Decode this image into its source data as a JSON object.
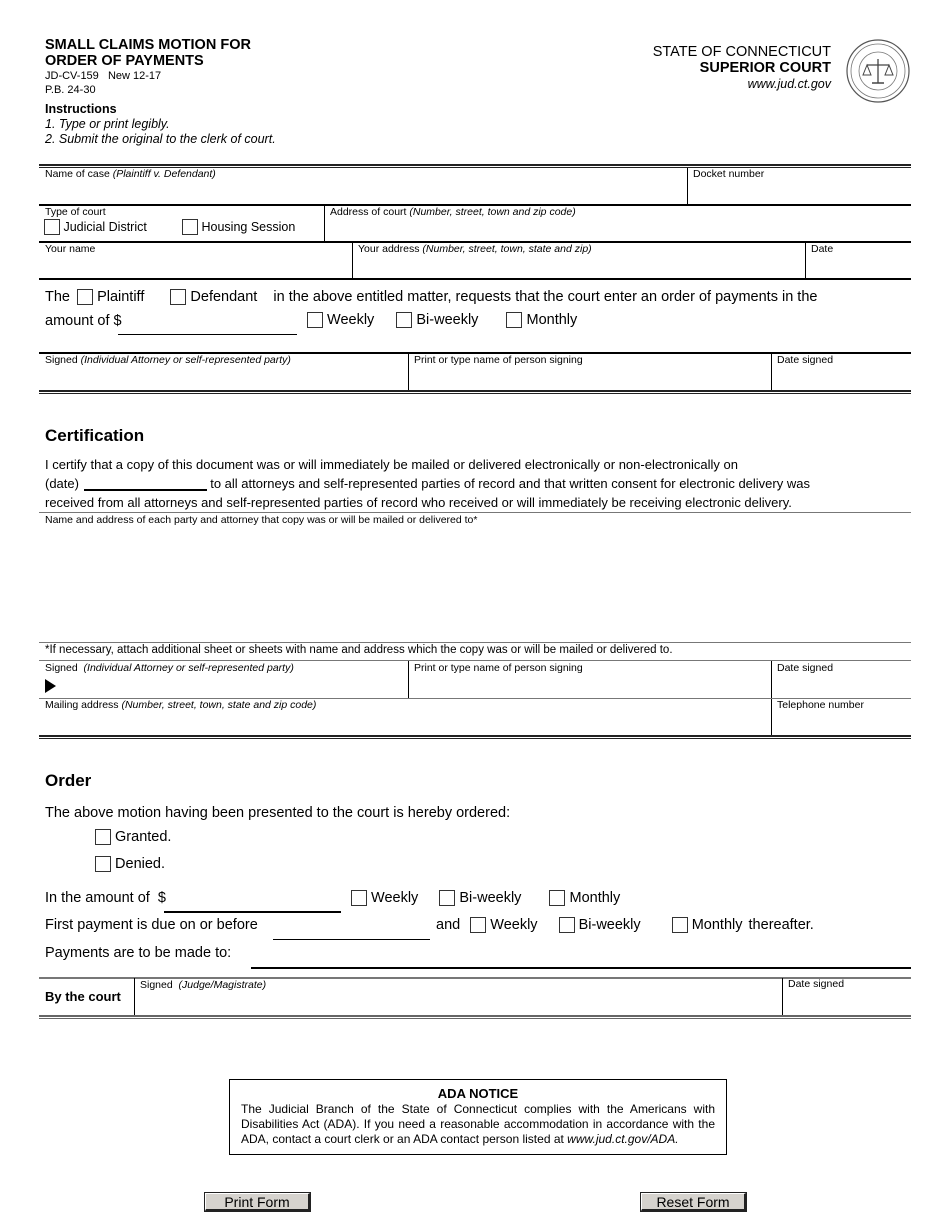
{
  "header": {
    "title_line1": "SMALL CLAIMS MOTION FOR",
    "title_line2": "ORDER OF PAYMENTS",
    "form_number": "JD-CV-159   New 12-17",
    "practice_book": "P.B. 24-30",
    "instructions_heading": "Instructions",
    "instructions": [
      "1. Type or print legibly.",
      "2. Submit the original to the clerk of court."
    ],
    "state": "STATE OF CONNECTICUT",
    "court": "SUPERIOR COURT",
    "website": "www.jud.ct.gov",
    "seal_icon": "state-seal-icon"
  },
  "case_info": {
    "name_of_case": "Name of case",
    "name_of_case_hint": "(Plaintiff v. Defendant)",
    "docket_number": "Docket number",
    "type_of_court": "Type of court",
    "court_options": [
      "Judicial District",
      "Housing Session"
    ],
    "address_of_court": "Address of court",
    "address_of_court_hint": "(Number, street, town and zip code)",
    "your_name": "Your name",
    "your_address": "Your address",
    "your_address_hint": "(Number, street, town, state and zip)",
    "date": "Date"
  },
  "motion": {
    "the": "The",
    "plaintiff": "Plaintiff",
    "defendant": "Defendant",
    "sentence": "in the above entitled matter, requests that the court enter an order of payments in the",
    "amount_of": "amount of",
    "currency": "$",
    "frequency": [
      "Weekly",
      "Bi-weekly",
      "Monthly"
    ],
    "signed": "Signed",
    "signed_hint": "(Individual Attorney or self-represented party)",
    "print_name": "Print or type name of person signing",
    "date_signed": "Date signed"
  },
  "certification": {
    "heading": "Certification",
    "line1": "I certify that a copy of this document was or will immediately be mailed or delivered electronically or non-electronically on",
    "date_label": "(date)",
    "line2": "to all attorneys and self-represented parties of record and that written consent for electronic delivery was",
    "line3": "received from all attorneys and self-represented parties of record who received or will immediately be receiving electronic delivery.",
    "name_address_label": "Name and address of each party and attorney that copy was or will be mailed or delivered to*",
    "footnote": "*If necessary, attach additional sheet or sheets with name and address which the copy was or will be mailed or delivered to.",
    "signed": "Signed",
    "signed_hint": "(Individual Attorney or self-represented party)",
    "print_name": "Print or type name of person signing",
    "date_signed": "Date signed",
    "mailing_address": "Mailing address",
    "mailing_address_hint": "(Number, street, town, state and zip code)",
    "telephone": "Telephone number"
  },
  "order": {
    "heading": "Order",
    "intro": "The above motion having been presented to the court is hereby ordered:",
    "granted": "Granted.",
    "denied": "Denied.",
    "in_amount_of": "In the amount of",
    "currency": "$",
    "frequency": [
      "Weekly",
      "Bi-weekly",
      "Monthly"
    ],
    "first_payment": "First payment is due on or before",
    "and": "and",
    "thereafter": "thereafter.",
    "payments_to": "Payments are to be made to:",
    "by_the_court": "By the court",
    "signed": "Signed",
    "signed_hint": "(Judge/Magistrate)",
    "date_signed": "Date signed"
  },
  "ada": {
    "heading": "ADA NOTICE",
    "body": "The Judicial Branch of the State of Connecticut complies with the Americans with Disabilities Act (ADA). If you need a reasonable accommodation in accordance with the ADA, contact a court clerk or an ADA contact person listed at ",
    "link": "www.jud.ct.gov/ADA."
  },
  "buttons": {
    "print": "Print Form",
    "reset": "Reset Form"
  }
}
